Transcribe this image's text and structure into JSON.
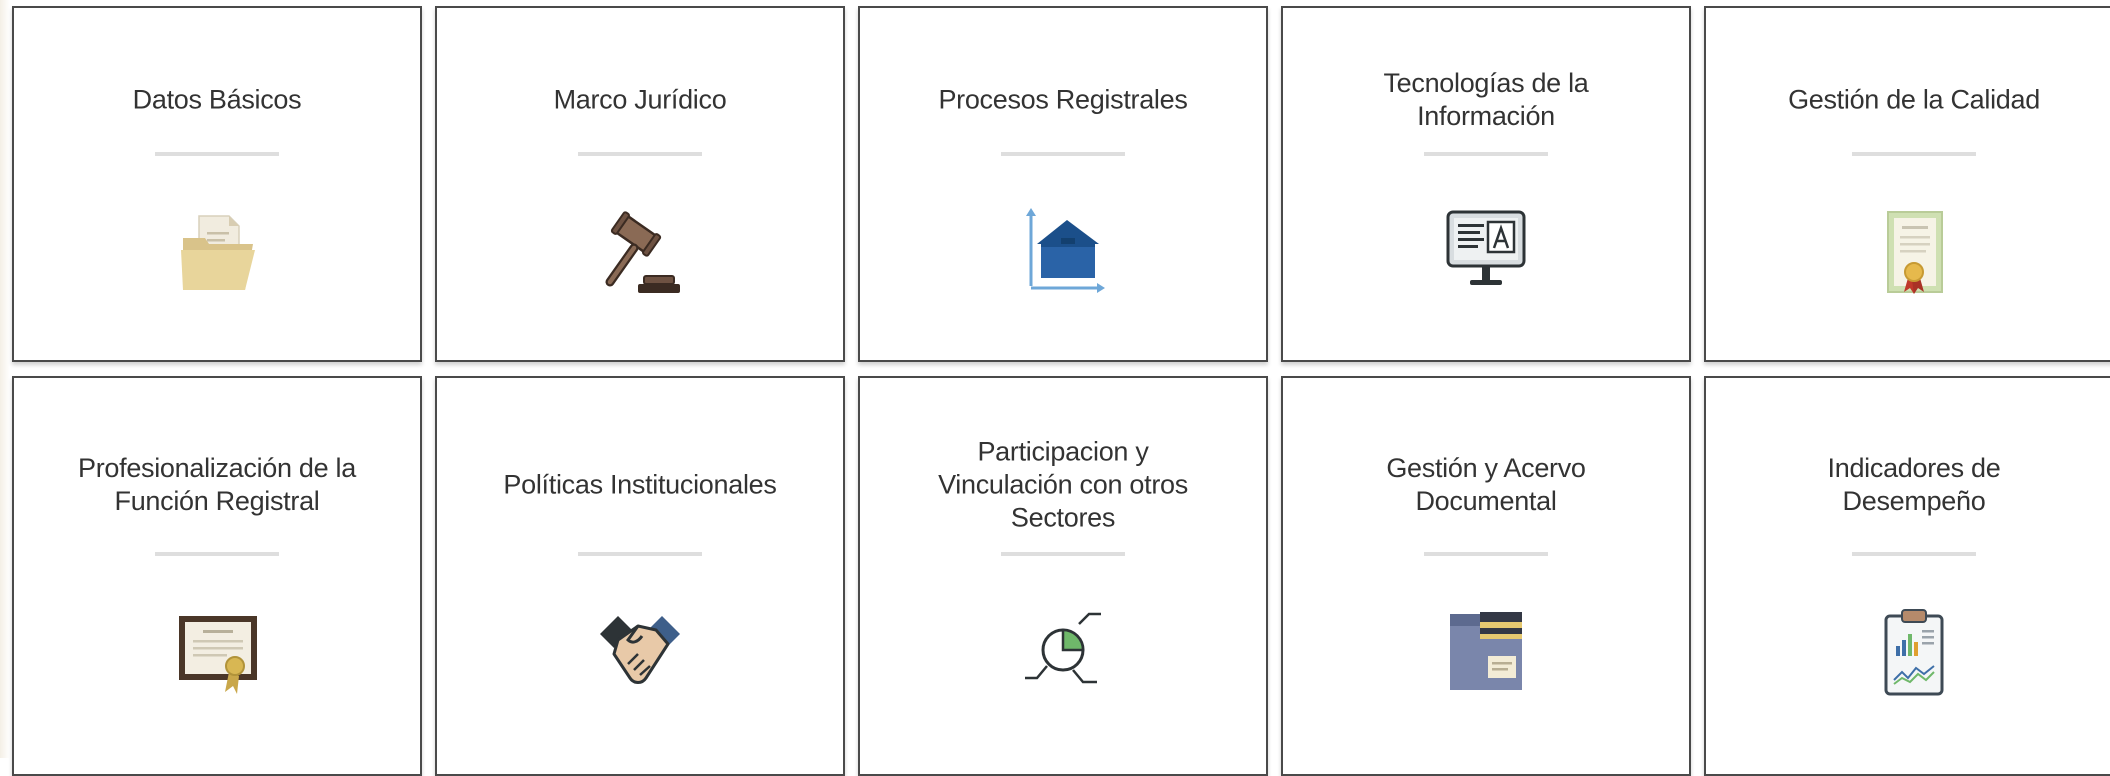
{
  "cards": [
    {
      "title": "Datos Básicos",
      "icon": "folder-icon"
    },
    {
      "title": "Marco Jurídico",
      "icon": "gavel-icon"
    },
    {
      "title": "Procesos Registrales",
      "icon": "house-measure-icon"
    },
    {
      "title": "Tecnologías de la\nInformación",
      "icon": "monitor-icon"
    },
    {
      "title": "Gestión de la Calidad",
      "icon": "certificate-icon"
    },
    {
      "title": "Profesionalización de la\nFunción Registral",
      "icon": "diploma-icon"
    },
    {
      "title": "Políticas Institucionales",
      "icon": "handshake-icon"
    },
    {
      "title": "Participacion y\nVinculación con otros\nSectores",
      "icon": "pie-connect-icon"
    },
    {
      "title": "Gestión y Acervo\nDocumental",
      "icon": "file-folder-icon"
    },
    {
      "title": "Indicadores de\nDesempeño",
      "icon": "clipboard-chart-icon"
    }
  ]
}
